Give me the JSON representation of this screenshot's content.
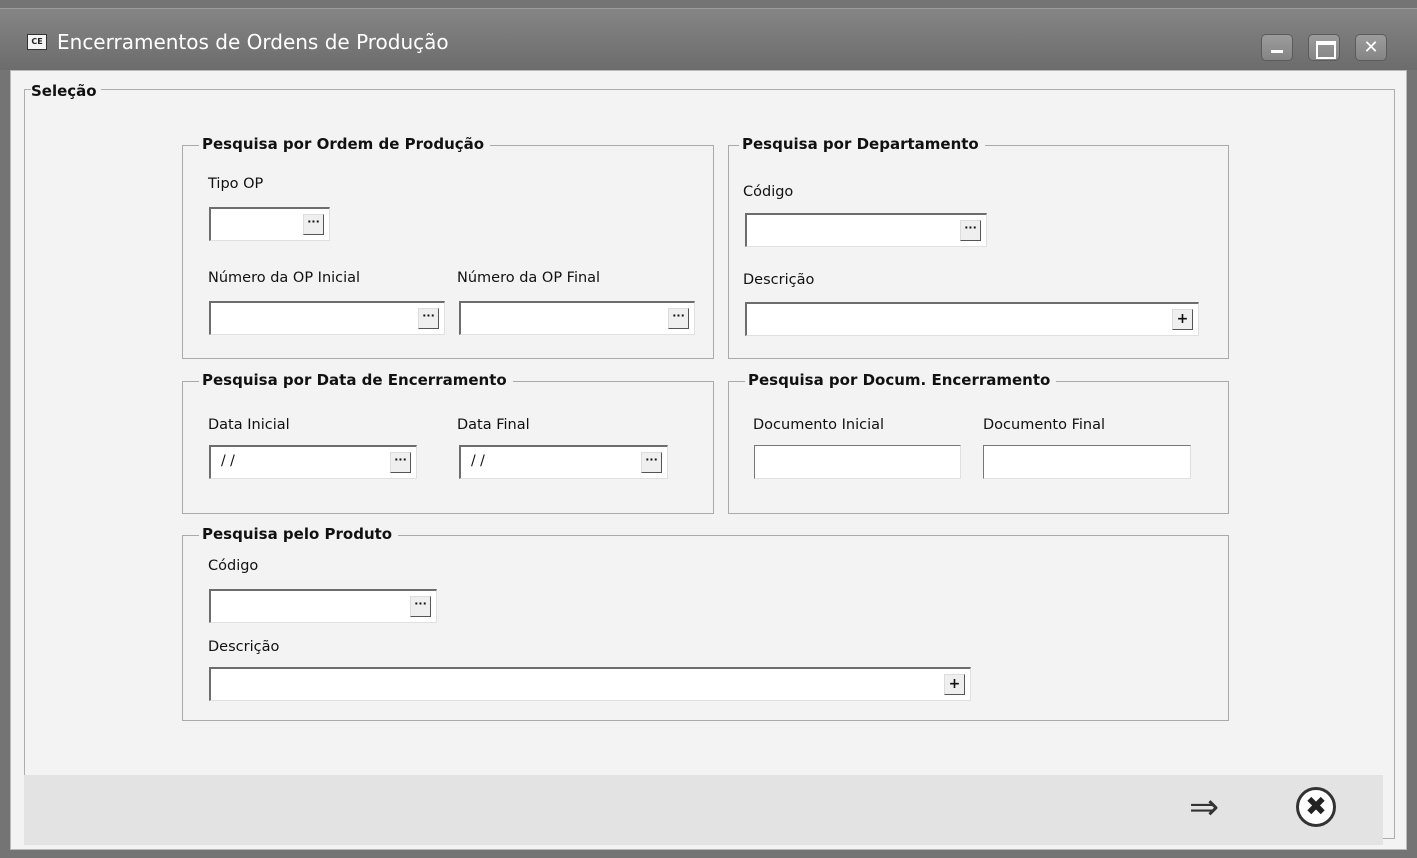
{
  "window": {
    "icon_text": "CE",
    "title": "Encerramentos de Ordens de Produção",
    "min_glyph": "",
    "max_glyph": "",
    "close_glyph": "✕"
  },
  "selecao": {
    "legend": "Seleção"
  },
  "ordem": {
    "legend": "Pesquisa por Ordem de Produção",
    "tipo_label": "Tipo OP",
    "tipo_value": "",
    "inicial_label": "Número da OP Inicial",
    "inicial_value": "",
    "final_label": "Número da OP Final",
    "final_value": ""
  },
  "departamento": {
    "legend": "Pesquisa por Departamento",
    "codigo_label": "Código",
    "codigo_value": "",
    "descricao_label": "Descrição",
    "descricao_value": ""
  },
  "data": {
    "legend": "Pesquisa por Data de Encerramento",
    "inicial_label": "Data Inicial",
    "inicial_value": "/ /",
    "final_label": "Data Final",
    "final_value": "/ /"
  },
  "documento": {
    "legend": "Pesquisa por Docum. Encerramento",
    "inicial_label": "Documento Inicial",
    "inicial_value": "",
    "final_label": "Documento Final",
    "final_value": ""
  },
  "produto": {
    "legend": "Pesquisa pelo Produto",
    "codigo_label": "Código",
    "codigo_value": "",
    "descricao_label": "Descrição",
    "descricao_value": ""
  },
  "buttons": {
    "ellipsis_glyph": "···",
    "plus_glyph": "+",
    "next_glyph": "⇒",
    "cancel_glyph": "✖"
  }
}
